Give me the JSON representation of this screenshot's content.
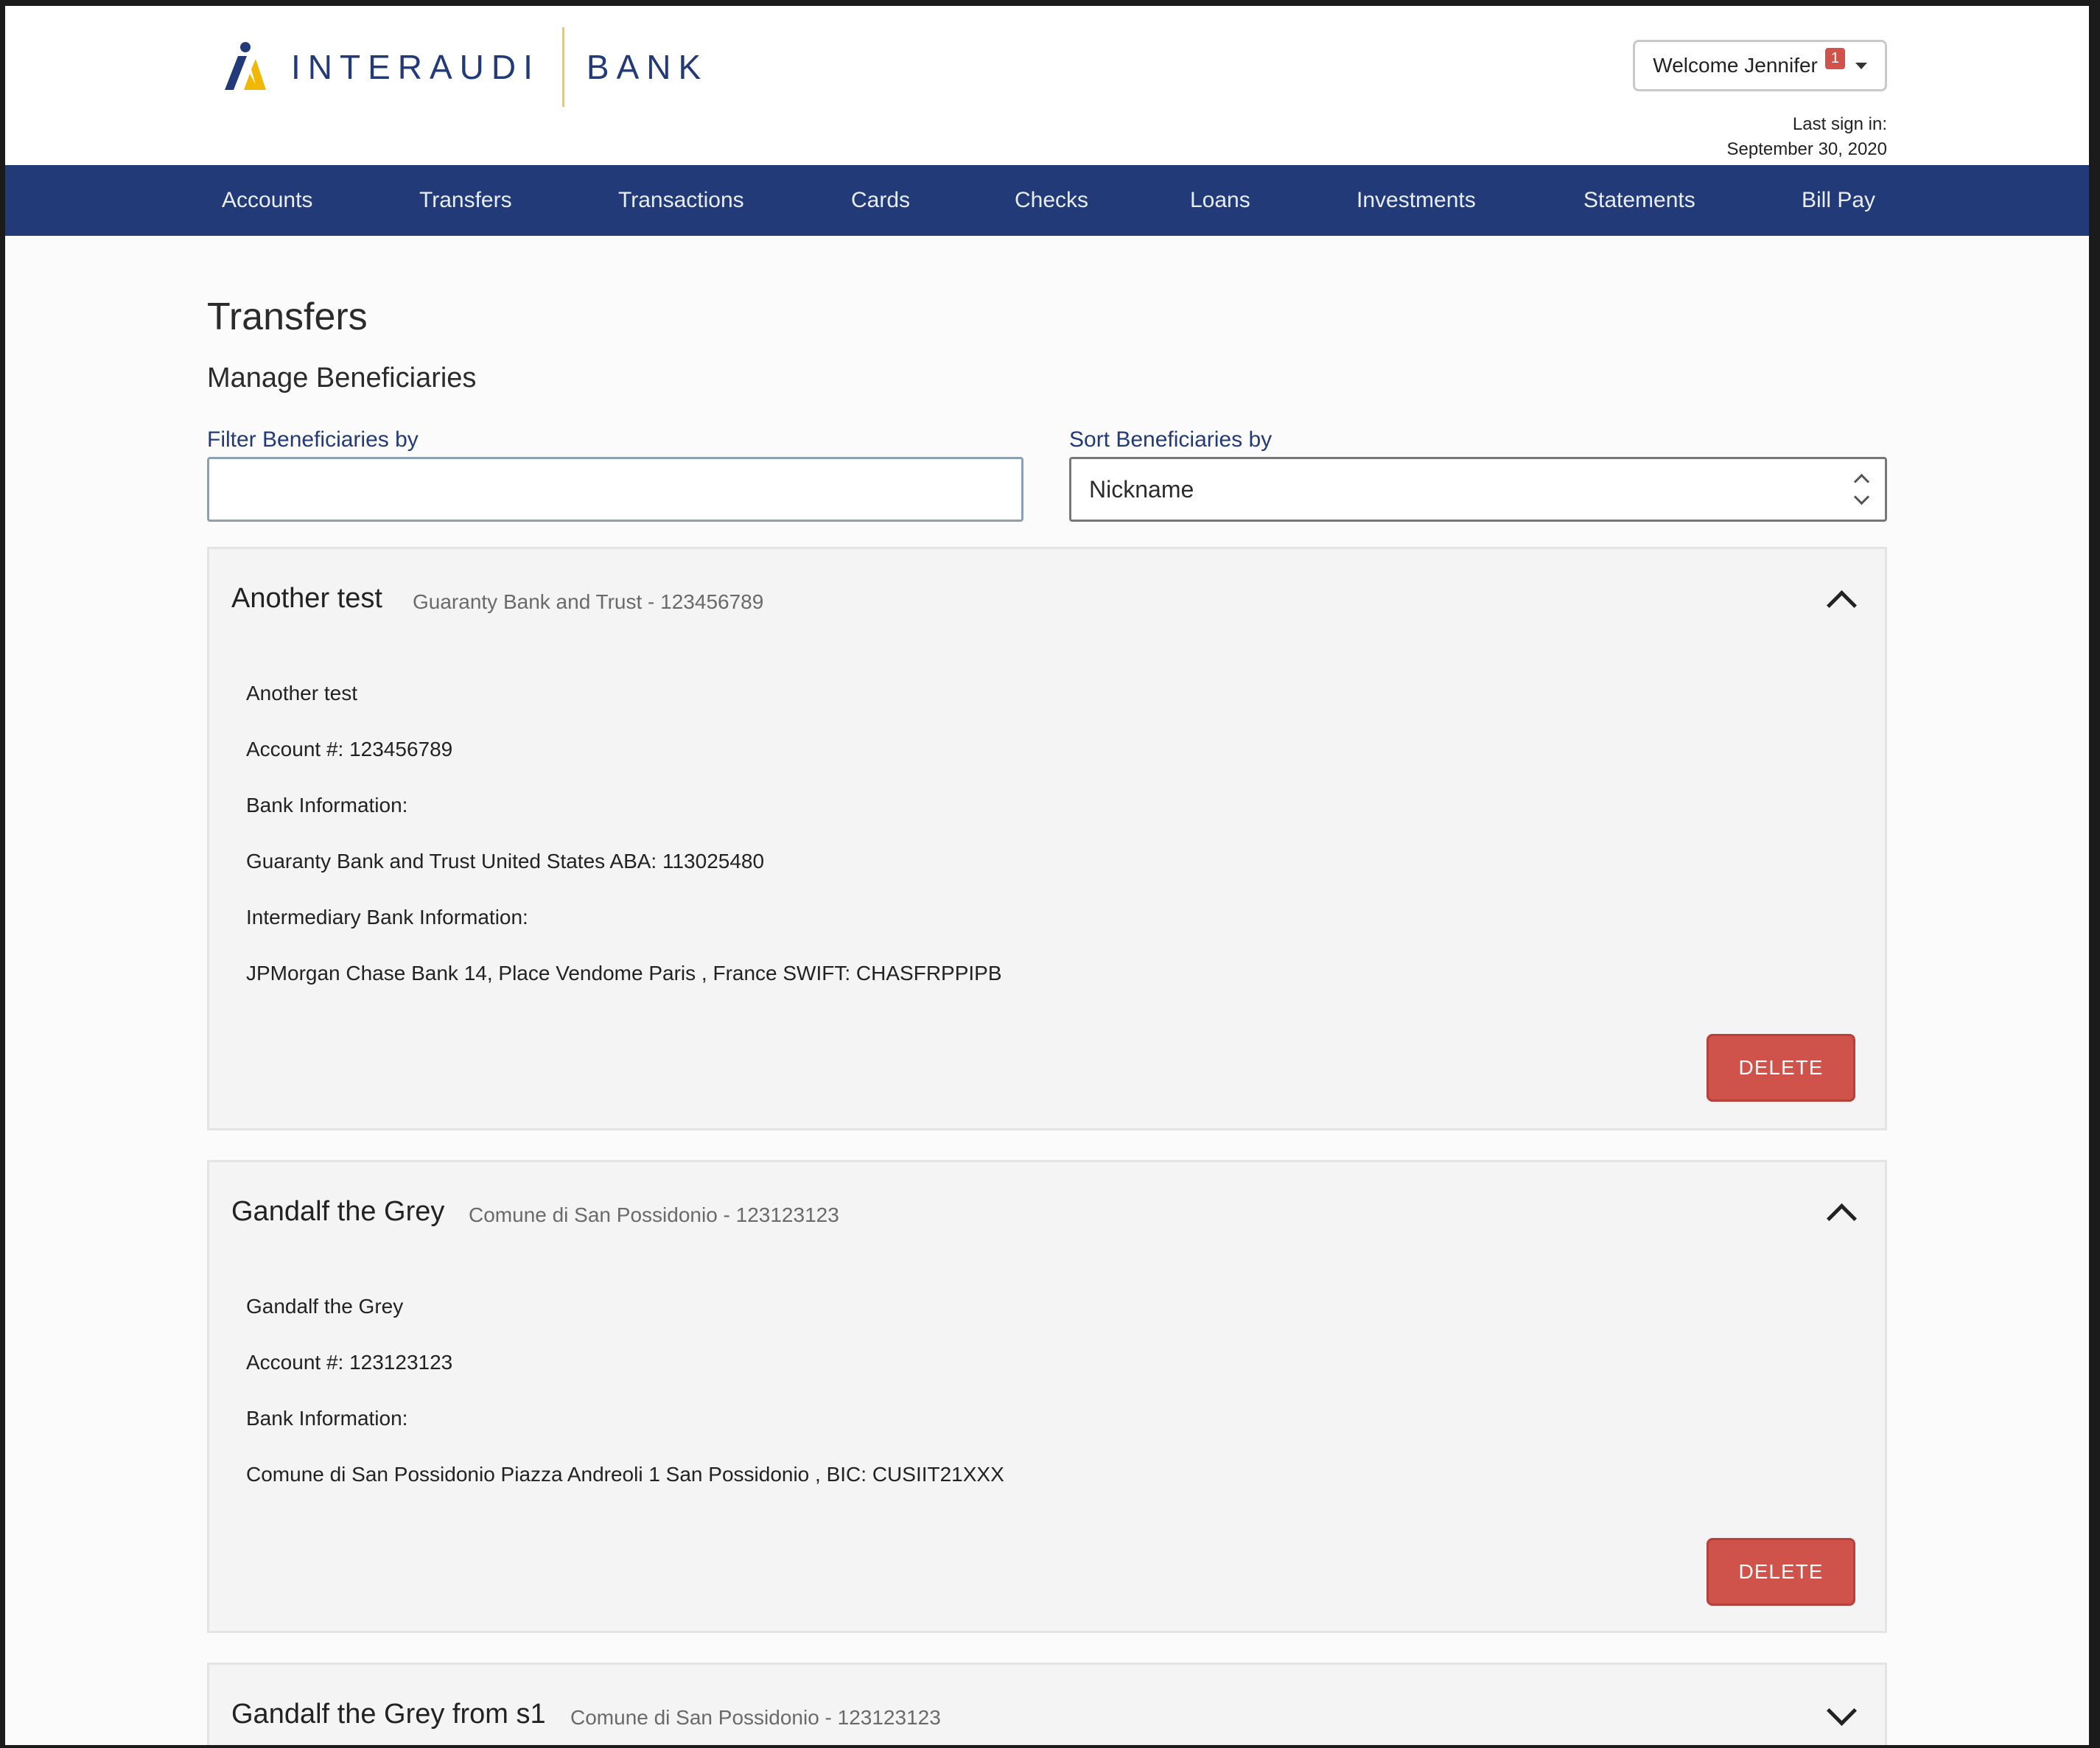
{
  "brand": {
    "name_left": "INTERAUDI",
    "name_right": "BANK",
    "accent": "#223a78",
    "gold": "#f2c94c"
  },
  "user": {
    "welcome": "Welcome Jennifer",
    "notifications": "1",
    "last_sign_label": "Last sign in:",
    "last_sign_date": "September 30, 2020"
  },
  "nav": [
    "Accounts",
    "Transfers",
    "Transactions",
    "Cards",
    "Checks",
    "Loans",
    "Investments",
    "Statements",
    "Bill Pay"
  ],
  "page": {
    "title": "Transfers",
    "subtitle": "Manage Beneficiaries"
  },
  "filter": {
    "label": "Filter Beneficiaries by",
    "value": "",
    "placeholder": ""
  },
  "sort": {
    "label": "Sort Beneficiaries by",
    "value": "Nickname"
  },
  "beneficiaries": [
    {
      "name": "Another test",
      "summary": "Guaranty Bank and Trust - 123456789",
      "expanded": true,
      "details": [
        "Another test",
        "Account #: 123456789",
        "Bank Information:",
        "Guaranty Bank and Trust United States ABA: 113025480",
        "Intermediary Bank Information:",
        "JPMorgan Chase Bank 14, Place Vendome Paris , France SWIFT: CHASFRPPIPB"
      ],
      "delete_label": "DELETE"
    },
    {
      "name": "Gandalf the Grey",
      "summary": "Comune di San Possidonio - 123123123",
      "expanded": true,
      "details": [
        "Gandalf the Grey",
        "Account #: 123123123",
        "Bank Information:",
        "Comune di San Possidonio Piazza Andreoli 1 San Possidonio , BIC: CUSIIT21XXX"
      ],
      "delete_label": "DELETE"
    },
    {
      "name": "Gandalf the Grey from s1",
      "summary": "Comune di San Possidonio - 123123123",
      "expanded": false
    }
  ],
  "colors": {
    "delete": "#d0534b",
    "nav_bg": "#223a78"
  }
}
